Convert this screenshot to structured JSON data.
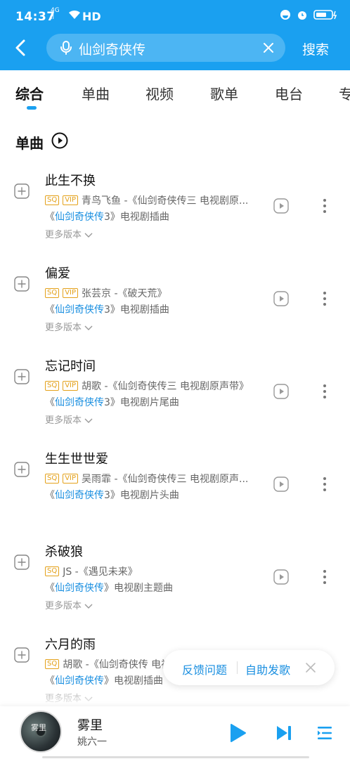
{
  "status": {
    "time": "14:37",
    "network": "4G",
    "network2": "ll",
    "hd": "HD"
  },
  "search": {
    "query": "仙剑奇侠传",
    "submit_label": "搜索"
  },
  "tabs": [
    {
      "label": "综合",
      "active": true
    },
    {
      "label": "单曲"
    },
    {
      "label": "视频"
    },
    {
      "label": "歌单"
    },
    {
      "label": "电台"
    },
    {
      "label": "专"
    }
  ],
  "section": {
    "title": "单曲"
  },
  "more_versions_label": "更多版本",
  "songs": [
    {
      "title": "此生不换",
      "badges": [
        "SQ",
        "VIP"
      ],
      "artist": "青鸟飞鱼 -《仙剑奇侠传三 电视剧原...",
      "desc_pre": "《",
      "desc_hl": "仙剑奇侠传",
      "desc_post": "3》电视剧插曲",
      "more": true
    },
    {
      "title": "偏爱",
      "badges": [
        "SQ",
        "VIP"
      ],
      "artist": "张芸京 -《破天荒》",
      "desc_pre": "《",
      "desc_hl": "仙剑奇侠传",
      "desc_post": "3》电视剧插曲",
      "more": true
    },
    {
      "title": "忘记时间",
      "badges": [
        "SQ",
        "VIP"
      ],
      "artist": "胡歌 -《仙剑奇侠传三 电视剧原声带》",
      "desc_pre": "《",
      "desc_hl": "仙剑奇侠传",
      "desc_post": "3》电视剧片尾曲",
      "more": true
    },
    {
      "title": "生生世世爱",
      "badges": [
        "SQ",
        "VIP"
      ],
      "artist": "吴雨霏 -《仙剑奇侠传三 电视剧原声...",
      "desc_pre": "《",
      "desc_hl": "仙剑奇侠传",
      "desc_post": "3》电视剧片头曲",
      "more": false
    },
    {
      "title": "杀破狼",
      "badges": [
        "SQ"
      ],
      "artist": "JS -《遇见未来》",
      "desc_pre": "《",
      "desc_hl": "仙剑奇侠传",
      "desc_post": "》电视剧主题曲",
      "more": true
    },
    {
      "title": "六月的雨",
      "badges": [
        "SQ"
      ],
      "artist": "胡歌 -《仙剑奇侠传 电视剧原声带》",
      "desc_pre": "《",
      "desc_hl": "仙剑奇侠传",
      "desc_post": "》电视剧插曲",
      "more": true
    }
  ],
  "feedback": {
    "report_label": "反馈问题",
    "help_label": "自助发歌"
  },
  "player": {
    "title": "雾里",
    "artist": "姚六一",
    "cover_text": "雾里"
  },
  "colors": {
    "accent": "#1aa0f0",
    "link": "#1a8fe0",
    "badge": "#e4a11a"
  }
}
